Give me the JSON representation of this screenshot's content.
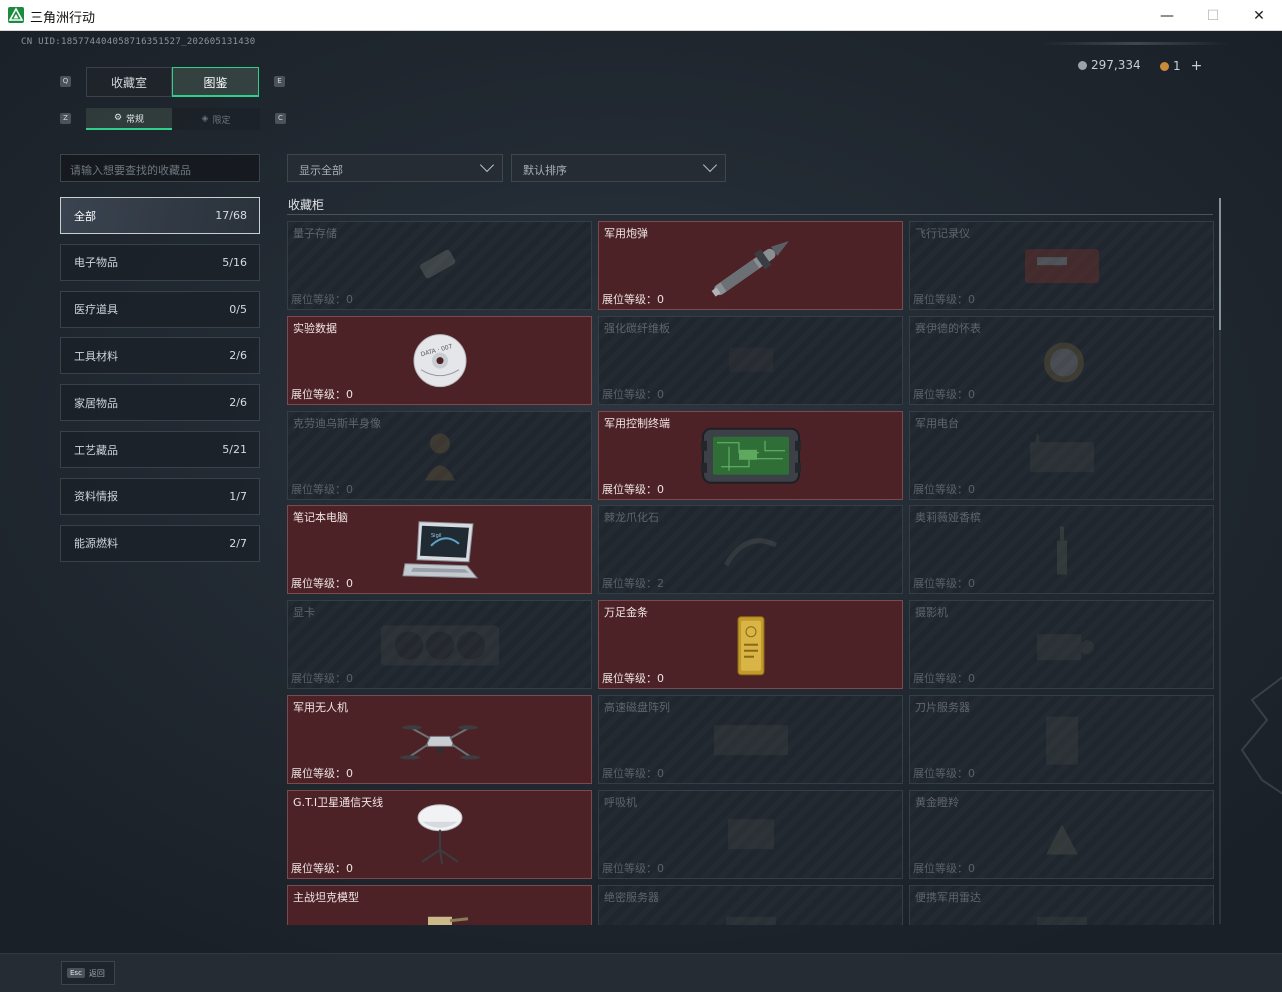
{
  "window": {
    "title": "三角洲行动"
  },
  "uid": "CN UID:185774404058716351527_202605131430",
  "currency": {
    "coins": "297,334",
    "tickets": "1",
    "add": "+"
  },
  "tabs": {
    "main": [
      "收藏室",
      "图鉴"
    ],
    "sub": [
      "常规",
      "限定"
    ]
  },
  "search": {
    "placeholder": "请输入想要查找的收藏品"
  },
  "filters": {
    "display": "显示全部",
    "sort": "默认排序"
  },
  "categories": [
    {
      "label": "全部",
      "count": "17/68"
    },
    {
      "label": "电子物品",
      "count": "5/16"
    },
    {
      "label": "医疗道具",
      "count": "0/5"
    },
    {
      "label": "工具材料",
      "count": "2/6"
    },
    {
      "label": "家居物品",
      "count": "2/6"
    },
    {
      "label": "工艺藏品",
      "count": "5/21"
    },
    {
      "label": "资料情报",
      "count": "1/7"
    },
    {
      "label": "能源燃料",
      "count": "2/7"
    }
  ],
  "section_title": "收藏柜",
  "items": [
    {
      "name": "量子存储",
      "level": "展位等级：0",
      "owned": false,
      "icon": "usb-drive-icon"
    },
    {
      "name": "军用炮弹",
      "level": "展位等级：0",
      "owned": true,
      "icon": "artillery-shell-icon"
    },
    {
      "name": "飞行记录仪",
      "level": "展位等级：0",
      "owned": false,
      "icon": "flight-recorder-icon"
    },
    {
      "name": "实验数据",
      "level": "展位等级：0",
      "owned": true,
      "icon": "disc-icon"
    },
    {
      "name": "强化碳纤维板",
      "level": "展位等级：0",
      "owned": false,
      "icon": "carbon-plate-icon"
    },
    {
      "name": "赛伊德的怀表",
      "level": "展位等级：0",
      "owned": false,
      "icon": "pocket-watch-icon"
    },
    {
      "name": "克劳迪乌斯半身像",
      "level": "展位等级：0",
      "owned": false,
      "icon": "bust-statue-icon"
    },
    {
      "name": "军用控制终端",
      "level": "展位等级：0",
      "owned": true,
      "icon": "control-terminal-icon"
    },
    {
      "name": "军用电台",
      "level": "展位等级：0",
      "owned": false,
      "icon": "radio-icon"
    },
    {
      "name": "笔记本电脑",
      "level": "展位等级：0",
      "owned": true,
      "icon": "laptop-icon"
    },
    {
      "name": "棘龙爪化石",
      "level": "展位等级：2",
      "owned": false,
      "icon": "claw-fossil-icon"
    },
    {
      "name": "奥莉薇娅香槟",
      "level": "展位等级：0",
      "owned": false,
      "icon": "champagne-icon"
    },
    {
      "name": "显卡",
      "level": "展位等级：0",
      "owned": false,
      "icon": "graphics-card-icon"
    },
    {
      "name": "万足金条",
      "level": "展位等级：0",
      "owned": true,
      "icon": "gold-bar-icon"
    },
    {
      "name": "摄影机",
      "level": "展位等级：0",
      "owned": false,
      "icon": "camera-icon"
    },
    {
      "name": "军用无人机",
      "level": "展位等级：0",
      "owned": true,
      "icon": "drone-icon"
    },
    {
      "name": "高速磁盘阵列",
      "level": "展位等级：0",
      "owned": false,
      "icon": "disk-array-icon"
    },
    {
      "name": "刀片服务器",
      "level": "展位等级：0",
      "owned": false,
      "icon": "blade-server-icon"
    },
    {
      "name": "G.T.I卫星通信天线",
      "level": "展位等级：0",
      "owned": true,
      "icon": "satellite-dish-icon"
    },
    {
      "name": "呼吸机",
      "level": "展位等级：0",
      "owned": false,
      "icon": "ventilator-icon"
    },
    {
      "name": "黄金瞪羚",
      "level": "展位等级：0",
      "owned": false,
      "icon": "gazelle-statue-icon"
    },
    {
      "name": "主战坦克模型",
      "level": "",
      "owned": true,
      "icon": "tank-model-icon"
    },
    {
      "name": "绝密服务器",
      "level": "",
      "owned": false,
      "icon": "secret-server-icon"
    },
    {
      "name": "便携军用雷达",
      "level": "",
      "owned": false,
      "icon": "radar-icon"
    }
  ],
  "bottom": {
    "esc_key": "Esc",
    "esc_label": "返回"
  },
  "colors": {
    "accent": "#2fd08a",
    "owned_card": "#4d2226",
    "locked_card": "#232a31"
  }
}
